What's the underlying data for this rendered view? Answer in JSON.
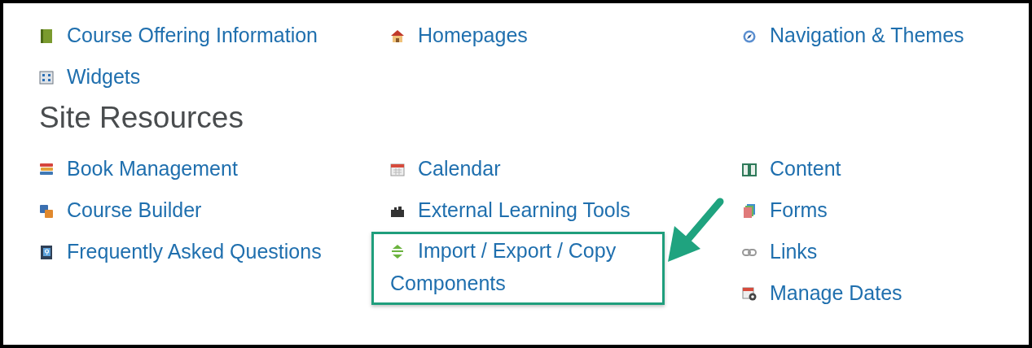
{
  "sections": [
    {
      "columns": [
        [
          {
            "label": "Course Offering Information",
            "kind": "green-book",
            "highlighted": false
          },
          {
            "label": "Widgets",
            "kind": "grid",
            "highlighted": false
          }
        ],
        [
          {
            "label": "Homepages",
            "kind": "house",
            "highlighted": false
          }
        ],
        [
          {
            "label": "Navigation & Themes",
            "kind": "compass",
            "highlighted": false
          }
        ]
      ]
    },
    {
      "heading": "Site Resources",
      "columns": [
        [
          {
            "label": "Book Management",
            "kind": "book-stack",
            "highlighted": false
          },
          {
            "label": "Course Builder",
            "kind": "blocks",
            "highlighted": false
          },
          {
            "label": "Frequently Asked Questions",
            "kind": "question-book",
            "highlighted": false
          }
        ],
        [
          {
            "label": "Calendar",
            "kind": "calendar",
            "highlighted": false
          },
          {
            "label": "External Learning Tools",
            "kind": "puzzle",
            "highlighted": false
          },
          {
            "label": "Import / Export / Copy Components",
            "kind": "up-down-arrows",
            "highlighted": true
          }
        ],
        [
          {
            "label": "Content",
            "kind": "open-book",
            "highlighted": false
          },
          {
            "label": "Forms",
            "kind": "forms",
            "highlighted": false
          },
          {
            "label": "Links",
            "kind": "chain",
            "highlighted": false
          },
          {
            "label": "Manage Dates",
            "kind": "calendar-gear",
            "highlighted": false
          }
        ]
      ]
    }
  ]
}
